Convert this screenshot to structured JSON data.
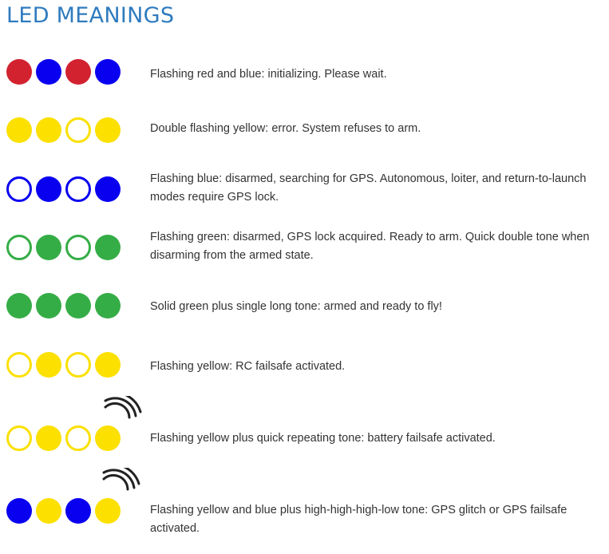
{
  "title": "LED MEANINGS",
  "colors": {
    "red": "#d22230",
    "blue": "#0a00f0",
    "yellow": "#fbe000",
    "green": "#35ad46",
    "title": "#2f7bbf",
    "text": "#333333"
  },
  "rows": [
    {
      "leds": [
        {
          "color": "red",
          "filled": true
        },
        {
          "color": "blue",
          "filled": true
        },
        {
          "color": "red",
          "filled": true
        },
        {
          "color": "blue",
          "filled": true
        }
      ],
      "text": "Flashing red and blue: initializing. Please wait.",
      "tone_icon": false
    },
    {
      "leds": [
        {
          "color": "yellow",
          "filled": true
        },
        {
          "color": "yellow",
          "filled": true
        },
        {
          "color": "yellow",
          "filled": false
        },
        {
          "color": "yellow",
          "filled": true
        }
      ],
      "text": "Double flashing yellow: error. System refuses to arm.",
      "tone_icon": false
    },
    {
      "leds": [
        {
          "color": "blue",
          "filled": false
        },
        {
          "color": "blue",
          "filled": true
        },
        {
          "color": "blue",
          "filled": false
        },
        {
          "color": "blue",
          "filled": true
        }
      ],
      "text": "Flashing blue: disarmed, searching for GPS. Autonomous, loiter, and return-to-launch modes require GPS lock.",
      "tone_icon": false
    },
    {
      "leds": [
        {
          "color": "green",
          "filled": false
        },
        {
          "color": "green",
          "filled": true
        },
        {
          "color": "green",
          "filled": false
        },
        {
          "color": "green",
          "filled": true
        }
      ],
      "text": "Flashing green: disarmed, GPS lock acquired. Ready to arm. Quick double tone when disarming from the armed state.",
      "tone_icon": false
    },
    {
      "leds": [
        {
          "color": "green",
          "filled": true
        },
        {
          "color": "green",
          "filled": true
        },
        {
          "color": "green",
          "filled": true
        },
        {
          "color": "green",
          "filled": true
        }
      ],
      "text": "Solid green plus single long tone: armed and ready to fly!",
      "tone_icon": false
    },
    {
      "leds": [
        {
          "color": "yellow",
          "filled": false
        },
        {
          "color": "yellow",
          "filled": true
        },
        {
          "color": "yellow",
          "filled": false
        },
        {
          "color": "yellow",
          "filled": true
        }
      ],
      "text": "Flashing yellow: RC failsafe activated.",
      "tone_icon": false
    },
    {
      "leds": [
        {
          "color": "yellow",
          "filled": false
        },
        {
          "color": "yellow",
          "filled": true
        },
        {
          "color": "yellow",
          "filled": false
        },
        {
          "color": "yellow",
          "filled": true
        }
      ],
      "text": "Flashing yellow plus quick repeating tone: battery failsafe activated.",
      "tone_icon": true
    },
    {
      "leds": [
        {
          "color": "blue",
          "filled": true
        },
        {
          "color": "yellow",
          "filled": true
        },
        {
          "color": "blue",
          "filled": true
        },
        {
          "color": "yellow",
          "filled": true
        }
      ],
      "text": "Flashing yellow and blue plus high-high-high-low tone: GPS glitch or GPS failsafe activated.",
      "tone_icon": true
    }
  ]
}
